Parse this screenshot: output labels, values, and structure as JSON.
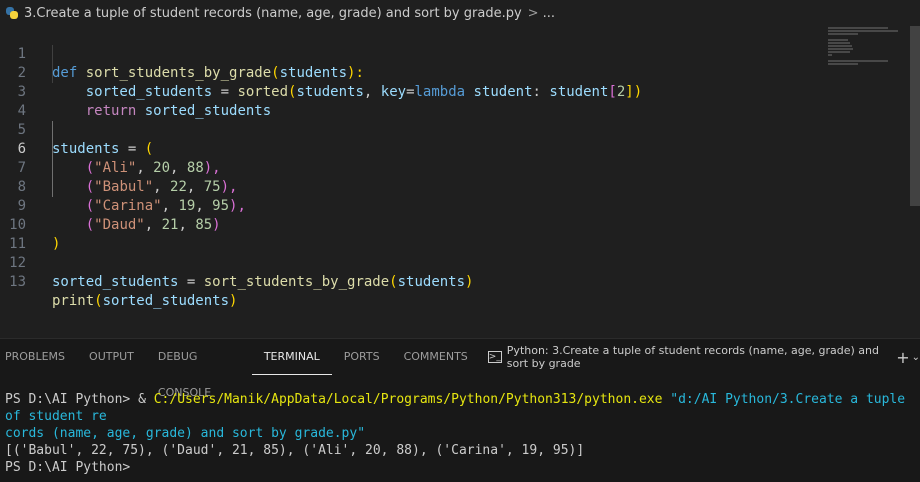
{
  "breadcrumb": {
    "filename": "3.Create a tuple of student records (name, age, grade) and sort by grade.py",
    "chevron": ">",
    "ellipsis": "..."
  },
  "editor": {
    "line_numbers": [
      "1",
      "2",
      "3",
      "4",
      "5",
      "6",
      "7",
      "8",
      "9",
      "10",
      "11",
      "12",
      "13"
    ]
  },
  "code": {
    "l1": [
      "def",
      " ",
      "sort_students_by_grade",
      "(",
      "students",
      "):"
    ],
    "l2": [
      "    ",
      "sorted_students",
      " = ",
      "sorted",
      "(",
      "students",
      ", ",
      "key",
      "=",
      "lambda",
      " ",
      "student",
      ": ",
      "student",
      "[",
      "2",
      "])"
    ],
    "l3": [
      "    ",
      "return",
      " ",
      "sorted_students"
    ],
    "l5": [
      "students",
      " = ",
      "("
    ],
    "l6": [
      "    ",
      "(",
      "\"Ali\"",
      ", ",
      "20",
      ", ",
      "88",
      "),"
    ],
    "l7": [
      "    ",
      "(",
      "\"Babul\"",
      ", ",
      "22",
      ", ",
      "75",
      "),"
    ],
    "l8": [
      "    ",
      "(",
      "\"Carina\"",
      ", ",
      "19",
      ", ",
      "95",
      "),"
    ],
    "l9": [
      "    ",
      "(",
      "\"Daud\"",
      ", ",
      "21",
      ", ",
      "85",
      ")"
    ],
    "l10": [
      ")"
    ],
    "l12": [
      "sorted_students",
      " = ",
      "sort_students_by_grade",
      "(",
      "students",
      ")"
    ],
    "l13": [
      "print",
      "(",
      "sorted_students",
      ")"
    ]
  },
  "panel": {
    "tabs": [
      "PROBLEMS",
      "OUTPUT",
      "DEBUG CONSOLE",
      "TERMINAL",
      "PORTS",
      "COMMENTS"
    ],
    "terminal_tab": "Python: 3.Create a tuple of student records (name, age, grade) and sort by grade",
    "plus": "+",
    "caret": "⌄"
  },
  "terminal": {
    "prompt1": "PS D:\\AI Python> ",
    "amp": "& ",
    "exe": "C:/Users/Manik/AppData/Local/Programs/Python/Python313/python.exe",
    "arg_line1": " \"d:/AI Python/3.Create a tuple of student re",
    "arg_line2": "cords (name, age, grade) and sort by grade.py\"",
    "output": "[('Babul', 22, 75), ('Daud', 21, 85), ('Ali', 20, 88), ('Carina', 19, 95)]",
    "prompt2": "PS D:\\AI Python>"
  }
}
